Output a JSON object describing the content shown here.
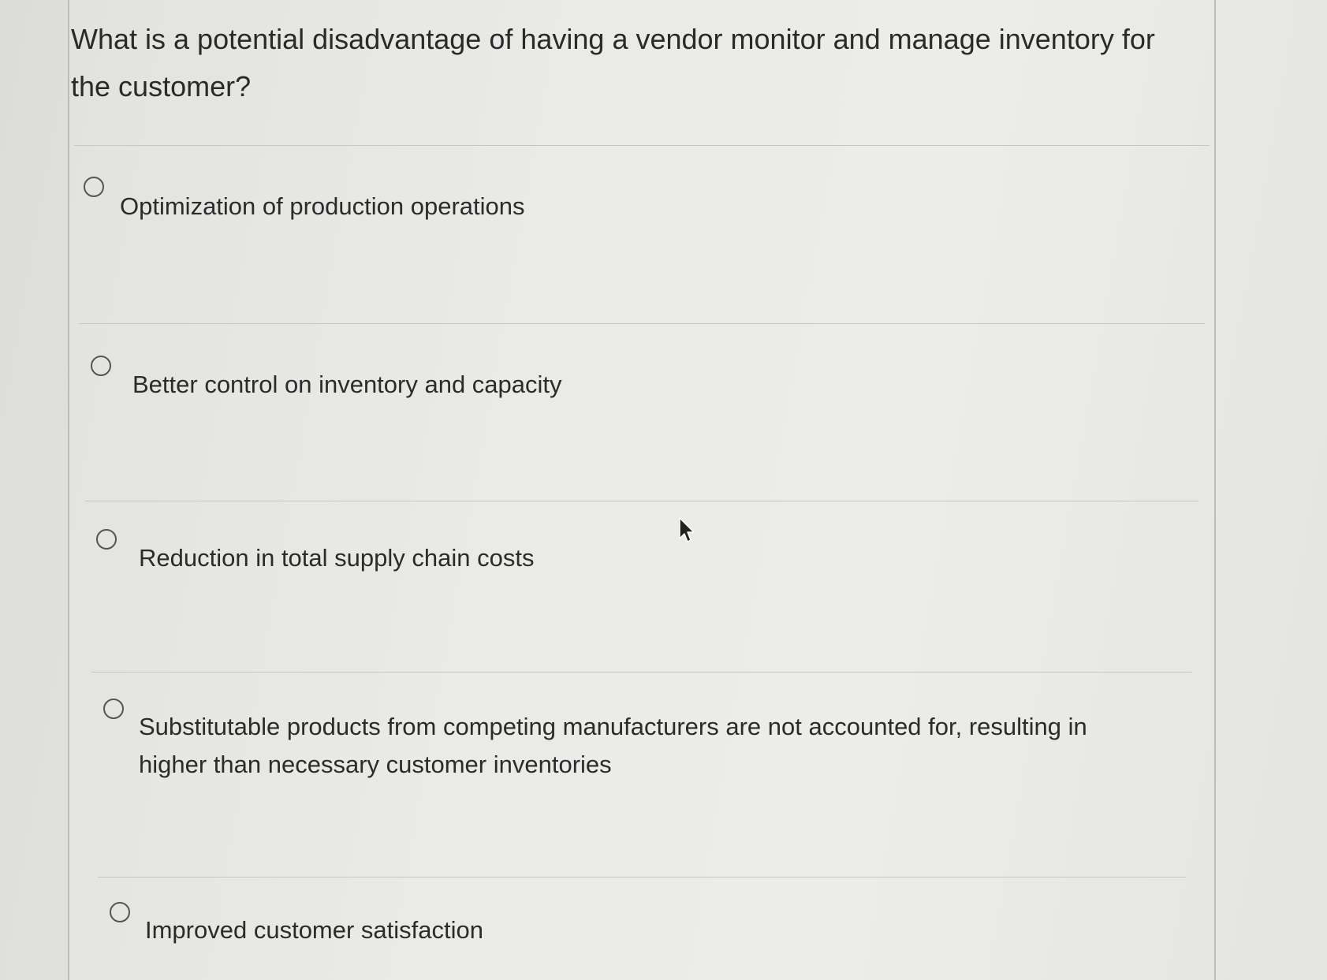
{
  "question": {
    "text": "What is a potential disadvantage of having a vendor monitor and manage inventory for the customer?"
  },
  "options": [
    {
      "label": "Optimization of production operations",
      "selected": false
    },
    {
      "label": "Better control on inventory and capacity",
      "selected": false
    },
    {
      "label": "Reduction in total supply chain costs",
      "selected": false
    },
    {
      "label": "Substitutable products from competing manufacturers are not accounted for, resulting in higher than necessary customer inventories",
      "selected": false
    },
    {
      "label": "Improved customer satisfaction",
      "selected": false
    }
  ],
  "icons": {
    "radio": "radio-unchecked-icon",
    "cursor": "mouse-pointer-icon"
  }
}
